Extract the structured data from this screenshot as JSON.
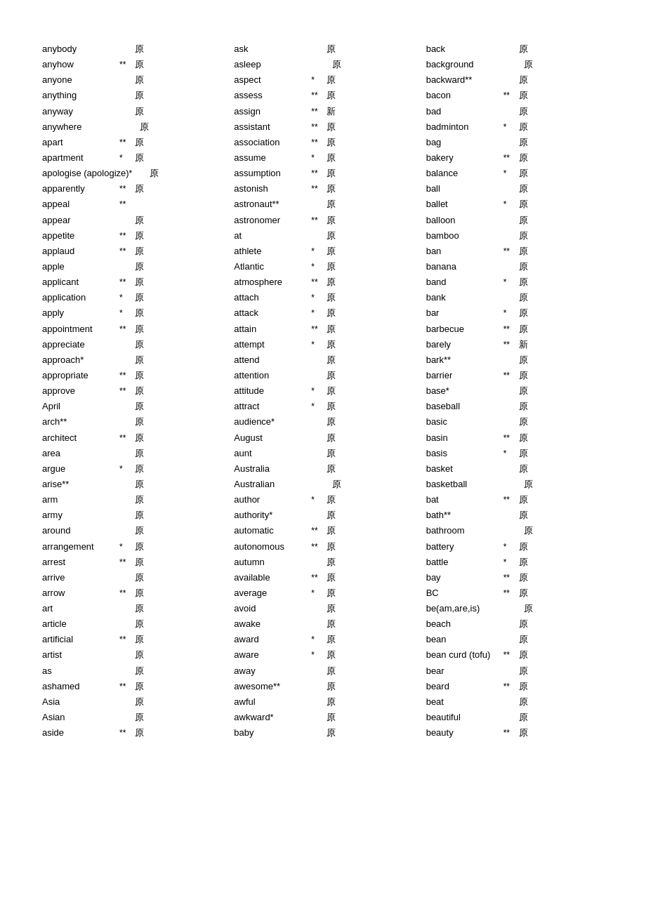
{
  "columns": [
    {
      "id": "col1",
      "items": [
        {
          "word": "anybody",
          "level": "",
          "kanji": "原",
          "kanji2": ""
        },
        {
          "word": "anyhow",
          "level": "**",
          "kanji": "原",
          "kanji2": ""
        },
        {
          "word": "anyone",
          "level": "",
          "kanji": "原",
          "kanji2": ""
        },
        {
          "word": "anything",
          "level": "",
          "kanji": "原",
          "kanji2": ""
        },
        {
          "word": "anyway",
          "level": "",
          "kanji": "原",
          "kanji2": ""
        },
        {
          "word": "anywhere",
          "level": "",
          "kanji": "",
          "kanji2": "原"
        },
        {
          "word": "apart",
          "level": "**",
          "kanji": "原",
          "kanji2": ""
        },
        {
          "word": "apartment",
          "level": "*",
          "kanji": "原",
          "kanji2": ""
        },
        {
          "word": "apologise (apologize)",
          "level": "*",
          "kanji": "",
          "kanji2": "原"
        },
        {
          "word": "apparently",
          "level": "**",
          "kanji": "原",
          "kanji2": ""
        },
        {
          "word": "appeal",
          "level": "**",
          "kanji": "",
          "kanji2": ""
        },
        {
          "word": "appear",
          "level": "",
          "kanji": "原",
          "kanji2": ""
        },
        {
          "word": "appetite",
          "level": "**",
          "kanji": "原",
          "kanji2": ""
        },
        {
          "word": "applaud",
          "level": "**",
          "kanji": "原",
          "kanji2": ""
        },
        {
          "word": "apple",
          "level": "",
          "kanji": "原",
          "kanji2": ""
        },
        {
          "word": "applicant",
          "level": "**",
          "kanji": "原",
          "kanji2": ""
        },
        {
          "word": "application",
          "level": "*",
          "kanji": "原",
          "kanji2": ""
        },
        {
          "word": "apply",
          "level": "*",
          "kanji": "原",
          "kanji2": ""
        },
        {
          "word": "appointment",
          "level": "**",
          "kanji": "原",
          "kanji2": ""
        },
        {
          "word": "appreciate",
          "level": "",
          "kanji": "原",
          "kanji2": ""
        },
        {
          "word": "approach*",
          "level": "",
          "kanji": "原",
          "kanji2": ""
        },
        {
          "word": "appropriate",
          "level": "**",
          "kanji": "原",
          "kanji2": ""
        },
        {
          "word": "approve",
          "level": "**",
          "kanji": "原",
          "kanji2": ""
        },
        {
          "word": "April",
          "level": "",
          "kanji": "原",
          "kanji2": ""
        },
        {
          "word": "arch**",
          "level": "",
          "kanji": "原",
          "kanji2": ""
        },
        {
          "word": "architect",
          "level": "**",
          "kanji": "原",
          "kanji2": ""
        },
        {
          "word": "area",
          "level": "",
          "kanji": "原",
          "kanji2": ""
        },
        {
          "word": "argue",
          "level": "*",
          "kanji": "原",
          "kanji2": ""
        },
        {
          "word": "arise**",
          "level": "",
          "kanji": "原",
          "kanji2": ""
        },
        {
          "word": "arm",
          "level": "",
          "kanji": "原",
          "kanji2": ""
        },
        {
          "word": "army",
          "level": "",
          "kanji": "原",
          "kanji2": ""
        },
        {
          "word": "around",
          "level": "",
          "kanji": "原",
          "kanji2": ""
        },
        {
          "word": "arrangement",
          "level": "*",
          "kanji": "原",
          "kanji2": ""
        },
        {
          "word": "arrest",
          "level": "**",
          "kanji": "原",
          "kanji2": ""
        },
        {
          "word": "arrive",
          "level": "",
          "kanji": "原",
          "kanji2": ""
        },
        {
          "word": "arrow",
          "level": "**",
          "kanji": "原",
          "kanji2": ""
        },
        {
          "word": "art",
          "level": "",
          "kanji": "原",
          "kanji2": ""
        },
        {
          "word": "article",
          "level": "",
          "kanji": "原",
          "kanji2": ""
        },
        {
          "word": "artificial",
          "level": "**",
          "kanji": "原",
          "kanji2": ""
        },
        {
          "word": "artist",
          "level": "",
          "kanji": "原",
          "kanji2": ""
        },
        {
          "word": "as",
          "level": "",
          "kanji": "原",
          "kanji2": ""
        },
        {
          "word": "ashamed",
          "level": "**",
          "kanji": "原",
          "kanji2": ""
        },
        {
          "word": "Asia",
          "level": "",
          "kanji": "原",
          "kanji2": ""
        },
        {
          "word": "Asian",
          "level": "",
          "kanji": "原",
          "kanji2": ""
        },
        {
          "word": "aside",
          "level": "**",
          "kanji": "原",
          "kanji2": ""
        }
      ]
    },
    {
      "id": "col2",
      "items": [
        {
          "word": "ask",
          "level": "",
          "kanji": "原",
          "kanji2": ""
        },
        {
          "word": "asleep",
          "level": "",
          "kanji": "",
          "kanji2": "原"
        },
        {
          "word": "aspect",
          "level": "*",
          "kanji": "原",
          "kanji2": ""
        },
        {
          "word": "assess",
          "level": "**",
          "kanji": "原",
          "kanji2": ""
        },
        {
          "word": "assign",
          "level": "**",
          "kanji": "新",
          "kanji2": ""
        },
        {
          "word": "assistant",
          "level": "**",
          "kanji": "原",
          "kanji2": ""
        },
        {
          "word": "association",
          "level": "**",
          "kanji": "原",
          "kanji2": ""
        },
        {
          "word": "assume",
          "level": "*",
          "kanji": "原",
          "kanji2": ""
        },
        {
          "word": "assumption",
          "level": "**",
          "kanji": "原",
          "kanji2": ""
        },
        {
          "word": "astonish",
          "level": "**",
          "kanji": "原",
          "kanji2": ""
        },
        {
          "word": "astronaut**",
          "level": "",
          "kanji": "原",
          "kanji2": ""
        },
        {
          "word": "astronomer",
          "level": "**",
          "kanji": "原",
          "kanji2": ""
        },
        {
          "word": "at",
          "level": "",
          "kanji": "原",
          "kanji2": ""
        },
        {
          "word": "athlete",
          "level": "*",
          "kanji": "原",
          "kanji2": ""
        },
        {
          "word": "Atlantic",
          "level": "*",
          "kanji": "原",
          "kanji2": ""
        },
        {
          "word": "atmosphere",
          "level": "**",
          "kanji": "原",
          "kanji2": ""
        },
        {
          "word": "attach",
          "level": "*",
          "kanji": "原",
          "kanji2": ""
        },
        {
          "word": "attack",
          "level": "*",
          "kanji": "原",
          "kanji2": ""
        },
        {
          "word": "attain",
          "level": "**",
          "kanji": "原",
          "kanji2": ""
        },
        {
          "word": "attempt",
          "level": "*",
          "kanji": "原",
          "kanji2": ""
        },
        {
          "word": "attend",
          "level": "",
          "kanji": "原",
          "kanji2": ""
        },
        {
          "word": "attention",
          "level": "",
          "kanji": "原",
          "kanji2": ""
        },
        {
          "word": "attitude",
          "level": "*",
          "kanji": "原",
          "kanji2": ""
        },
        {
          "word": "attract",
          "level": "*",
          "kanji": "原",
          "kanji2": ""
        },
        {
          "word": "audience*",
          "level": "",
          "kanji": "原",
          "kanji2": ""
        },
        {
          "word": "August",
          "level": "",
          "kanji": "原",
          "kanji2": ""
        },
        {
          "word": "aunt",
          "level": "",
          "kanji": "原",
          "kanji2": ""
        },
        {
          "word": "Australia",
          "level": "",
          "kanji": "原",
          "kanji2": ""
        },
        {
          "word": "Australian",
          "level": "",
          "kanji": "",
          "kanji2": "原"
        },
        {
          "word": "author",
          "level": "*",
          "kanji": "原",
          "kanji2": ""
        },
        {
          "word": "authority*",
          "level": "",
          "kanji": "原",
          "kanji2": ""
        },
        {
          "word": "automatic",
          "level": "**",
          "kanji": "原",
          "kanji2": ""
        },
        {
          "word": "autonomous",
          "level": "**",
          "kanji": "原",
          "kanji2": ""
        },
        {
          "word": "autumn",
          "level": "",
          "kanji": "原",
          "kanji2": ""
        },
        {
          "word": "available",
          "level": "**",
          "kanji": "原",
          "kanji2": ""
        },
        {
          "word": "average",
          "level": "*",
          "kanji": "原",
          "kanji2": ""
        },
        {
          "word": "avoid",
          "level": "",
          "kanji": "原",
          "kanji2": ""
        },
        {
          "word": "awake",
          "level": "",
          "kanji": "原",
          "kanji2": ""
        },
        {
          "word": "award",
          "level": "*",
          "kanji": "原",
          "kanji2": ""
        },
        {
          "word": "aware",
          "level": "*",
          "kanji": "原",
          "kanji2": ""
        },
        {
          "word": "away",
          "level": "",
          "kanji": "原",
          "kanji2": ""
        },
        {
          "word": "awesome**",
          "level": "",
          "kanji": "原",
          "kanji2": ""
        },
        {
          "word": "awful",
          "level": "",
          "kanji": "原",
          "kanji2": ""
        },
        {
          "word": "awkward*",
          "level": "",
          "kanji": "原",
          "kanji2": ""
        },
        {
          "word": "baby",
          "level": "",
          "kanji": "原",
          "kanji2": ""
        }
      ]
    },
    {
      "id": "col3",
      "items": [
        {
          "word": "back",
          "level": "",
          "kanji": "原",
          "kanji2": ""
        },
        {
          "word": "background",
          "level": "",
          "kanji": "",
          "kanji2": "原"
        },
        {
          "word": "backward**",
          "level": "",
          "kanji": "原",
          "kanji2": ""
        },
        {
          "word": "bacon",
          "level": "**",
          "kanji": "原",
          "kanji2": ""
        },
        {
          "word": "bad",
          "level": "",
          "kanji": "原",
          "kanji2": ""
        },
        {
          "word": "badminton",
          "level": "*",
          "kanji": "原",
          "kanji2": ""
        },
        {
          "word": "bag",
          "level": "",
          "kanji": "原",
          "kanji2": ""
        },
        {
          "word": "bakery",
          "level": "**",
          "kanji": "原",
          "kanji2": ""
        },
        {
          "word": "balance",
          "level": "*",
          "kanji": "原",
          "kanji2": ""
        },
        {
          "word": "ball",
          "level": "",
          "kanji": "原",
          "kanji2": ""
        },
        {
          "word": "ballet",
          "level": "*",
          "kanji": "原",
          "kanji2": ""
        },
        {
          "word": "balloon",
          "level": "",
          "kanji": "原",
          "kanji2": ""
        },
        {
          "word": "bamboo",
          "level": "",
          "kanji": "原",
          "kanji2": ""
        },
        {
          "word": "ban",
          "level": "**",
          "kanji": "原",
          "kanji2": ""
        },
        {
          "word": "banana",
          "level": "",
          "kanji": "原",
          "kanji2": ""
        },
        {
          "word": "band",
          "level": "*",
          "kanji": "原",
          "kanji2": ""
        },
        {
          "word": "bank",
          "level": "",
          "kanji": "原",
          "kanji2": ""
        },
        {
          "word": "bar",
          "level": "*",
          "kanji": "原",
          "kanji2": ""
        },
        {
          "word": "barbecue",
          "level": "**",
          "kanji": "原",
          "kanji2": ""
        },
        {
          "word": "barely",
          "level": "**",
          "kanji": "新",
          "kanji2": ""
        },
        {
          "word": "bark**",
          "level": "",
          "kanji": "原",
          "kanji2": ""
        },
        {
          "word": "barrier",
          "level": "**",
          "kanji": "原",
          "kanji2": ""
        },
        {
          "word": "base*",
          "level": "",
          "kanji": "原",
          "kanji2": ""
        },
        {
          "word": "baseball",
          "level": "",
          "kanji": "原",
          "kanji2": ""
        },
        {
          "word": "basic",
          "level": "",
          "kanji": "原",
          "kanji2": ""
        },
        {
          "word": "basin",
          "level": "**",
          "kanji": "原",
          "kanji2": ""
        },
        {
          "word": "basis",
          "level": "*",
          "kanji": "原",
          "kanji2": ""
        },
        {
          "word": "basket",
          "level": "",
          "kanji": "原",
          "kanji2": ""
        },
        {
          "word": "basketball",
          "level": "",
          "kanji": "",
          "kanji2": "原"
        },
        {
          "word": "bat",
          "level": "**",
          "kanji": "原",
          "kanji2": ""
        },
        {
          "word": "bath**",
          "level": "",
          "kanji": "原",
          "kanji2": ""
        },
        {
          "word": "bathroom",
          "level": "",
          "kanji": "",
          "kanji2": "原"
        },
        {
          "word": "battery",
          "level": "*",
          "kanji": "原",
          "kanji2": ""
        },
        {
          "word": "battle",
          "level": "*",
          "kanji": "原",
          "kanji2": ""
        },
        {
          "word": "bay",
          "level": "**",
          "kanji": "原",
          "kanji2": ""
        },
        {
          "word": "BC",
          "level": "**",
          "kanji": "原",
          "kanji2": ""
        },
        {
          "word": "be(am,are,is)",
          "level": "",
          "kanji": "",
          "kanji2": "原"
        },
        {
          "word": "beach",
          "level": "",
          "kanji": "原",
          "kanji2": ""
        },
        {
          "word": "bean",
          "level": "",
          "kanji": "原",
          "kanji2": ""
        },
        {
          "word": "bean curd (tofu)",
          "level": "**",
          "kanji": "原",
          "kanji2": ""
        },
        {
          "word": "bear",
          "level": "",
          "kanji": "原",
          "kanji2": ""
        },
        {
          "word": "beard",
          "level": "**",
          "kanji": "原",
          "kanji2": ""
        },
        {
          "word": "beat",
          "level": "",
          "kanji": "原",
          "kanji2": ""
        },
        {
          "word": "beautiful",
          "level": "",
          "kanji": "原",
          "kanji2": ""
        },
        {
          "word": "beauty",
          "level": "**",
          "kanji": "原",
          "kanji2": ""
        }
      ]
    }
  ]
}
